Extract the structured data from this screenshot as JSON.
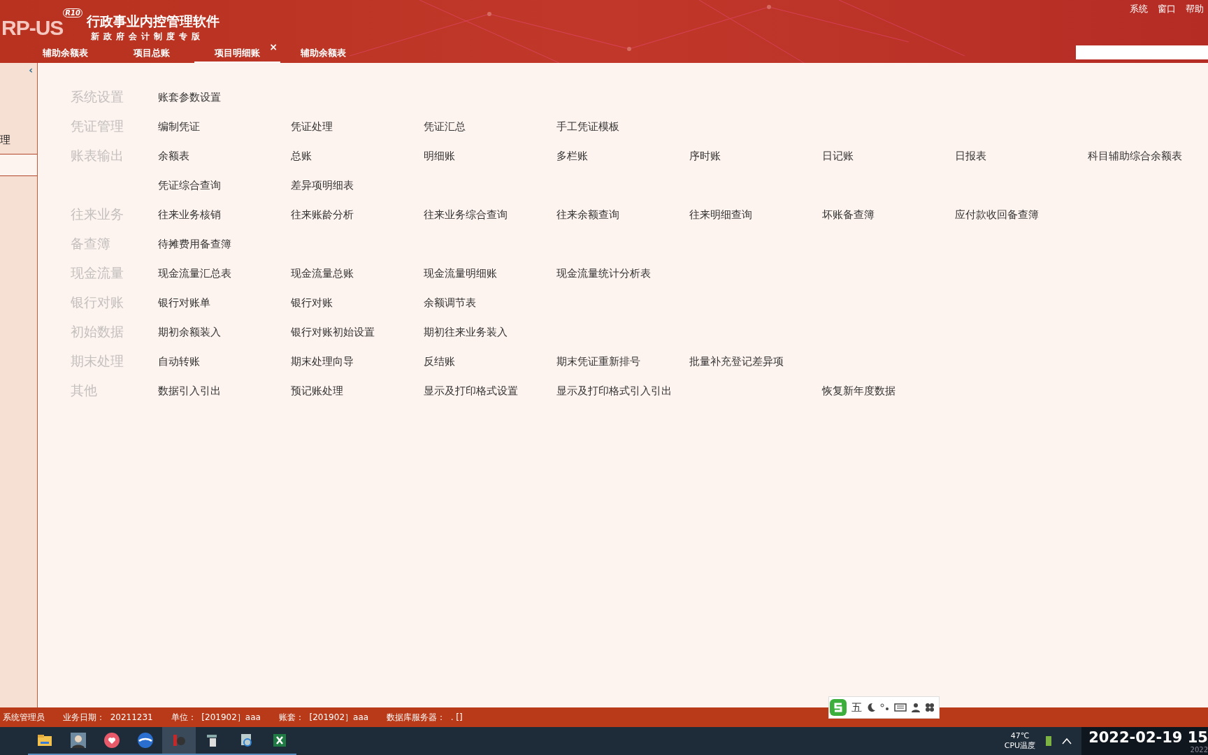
{
  "header": {
    "logo_text": "RP-US",
    "logo_badge": "R10",
    "title": "行政事业内控管理软件",
    "subtitle": "新政府会计制度专版",
    "menu": [
      "系统",
      "窗口",
      "帮助"
    ]
  },
  "tabs": [
    {
      "label": "辅助余额表",
      "selected": false
    },
    {
      "label": "项目总账",
      "selected": false
    },
    {
      "label": "项目明细账",
      "selected": true,
      "close": "×"
    },
    {
      "label": "辅助余额表",
      "selected": false
    }
  ],
  "sidebar": {
    "collapse": "‹",
    "item": "理"
  },
  "menu_rows": [
    {
      "category": "系统设置",
      "items": [
        {
          "label": "账套参数设置"
        }
      ]
    },
    {
      "category": "凭证管理",
      "items": [
        {
          "label": "编制凭证"
        },
        {
          "label": "凭证处理"
        },
        {
          "label": "凭证汇总"
        },
        {
          "label": "手工凭证模板"
        }
      ]
    },
    {
      "category": "账表输出",
      "items": [
        {
          "label": "余额表"
        },
        {
          "label": "总账"
        },
        {
          "label": "明细账"
        },
        {
          "label": "多栏账"
        },
        {
          "label": "序时账"
        },
        {
          "label": "日记账"
        },
        {
          "label": "日报表"
        },
        {
          "label": "科目辅助综合余额表"
        },
        {
          "label": "凭证综合查询"
        },
        {
          "label": "差异项明细表"
        }
      ]
    },
    {
      "category": "往来业务",
      "items": [
        {
          "label": "往来业务核销"
        },
        {
          "label": "往来账龄分析"
        },
        {
          "label": "往来业务综合查询"
        },
        {
          "label": "往来余额查询"
        },
        {
          "label": "往来明细查询"
        },
        {
          "label": "坏账备查簿"
        },
        {
          "label": "应付款收回备查簿"
        }
      ]
    },
    {
      "category": "备查簿",
      "items": [
        {
          "label": "待摊费用备查簿"
        }
      ]
    },
    {
      "category": "现金流量",
      "items": [
        {
          "label": "现金流量汇总表"
        },
        {
          "label": "现金流量总账"
        },
        {
          "label": "现金流量明细账"
        },
        {
          "label": "现金流量统计分析表"
        }
      ]
    },
    {
      "category": "银行对账",
      "items": [
        {
          "label": "银行对账单"
        },
        {
          "label": "银行对账"
        },
        {
          "label": "余额调节表"
        }
      ]
    },
    {
      "category": "初始数据",
      "items": [
        {
          "label": "期初余额装入"
        },
        {
          "label": "银行对账初始设置"
        },
        {
          "label": "期初往来业务装入"
        }
      ]
    },
    {
      "category": "期末处理",
      "items": [
        {
          "label": "自动转账"
        },
        {
          "label": "期末处理向导"
        },
        {
          "label": "反结账"
        },
        {
          "label": "期末凭证重新排号"
        },
        {
          "label": "批量补充登记差异项"
        }
      ]
    },
    {
      "category": "其他",
      "items": [
        {
          "label": "数据引入引出"
        },
        {
          "label": "预记账处理"
        },
        {
          "label": "显示及打印格式设置"
        },
        {
          "label": "显示及打印格式引入引出"
        },
        {
          "label": "恢复新年度数据",
          "gap_before": true
        }
      ]
    }
  ],
  "ime_bar": {
    "mode": "五"
  },
  "status_bar": [
    {
      "label": "系统管理员"
    },
    {
      "label": "业务日期：",
      "value": "20211231"
    },
    {
      "label": "单位：",
      "value": "[201902］aaa"
    },
    {
      "label": "账套：",
      "value": "[201902］aaa"
    },
    {
      "label": "数据库服务器：",
      "value": ". []"
    }
  ],
  "taskbar": {
    "apps": [
      {
        "kind": "folder",
        "selected": false
      },
      {
        "kind": "avatar",
        "selected": false
      },
      {
        "kind": "heart",
        "selected": false
      },
      {
        "kind": "browser",
        "selected": false
      },
      {
        "kind": "erp",
        "selected": true
      },
      {
        "kind": "tool",
        "selected": false
      },
      {
        "kind": "network",
        "selected": false
      },
      {
        "kind": "excel",
        "selected": false
      }
    ],
    "temperature": "47℃",
    "temperature_label": "CPU温度",
    "clock": "2022-02-19 15",
    "clock_sub": "2022"
  }
}
